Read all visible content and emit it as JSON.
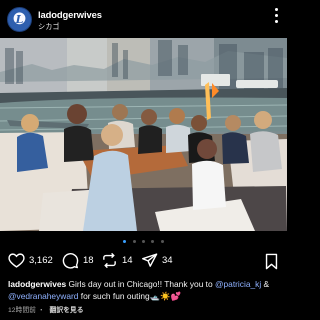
{
  "header": {
    "username": "ladodgerwives",
    "location": "シカゴ",
    "avatar": "L"
  },
  "post": {
    "image_alt": "Women on a boat in Chicago"
  },
  "actions": {
    "likes": "3,162",
    "comments": "18",
    "reposts": "14",
    "shares": "34"
  },
  "caption": {
    "username": "ladodgerwives",
    "text_before": " Girls day out in Chicago!! Thank you to ",
    "mention1": "@patricia_kj",
    "connector": " & ",
    "mention2": "@vedranaheyward",
    "text_after": " for such fun outing🛥️☀️💕"
  },
  "meta": {
    "time_ago": "12時間前",
    "translate": "翻訳を見る"
  },
  "carousel": {
    "count": 5,
    "active_index": 0
  }
}
